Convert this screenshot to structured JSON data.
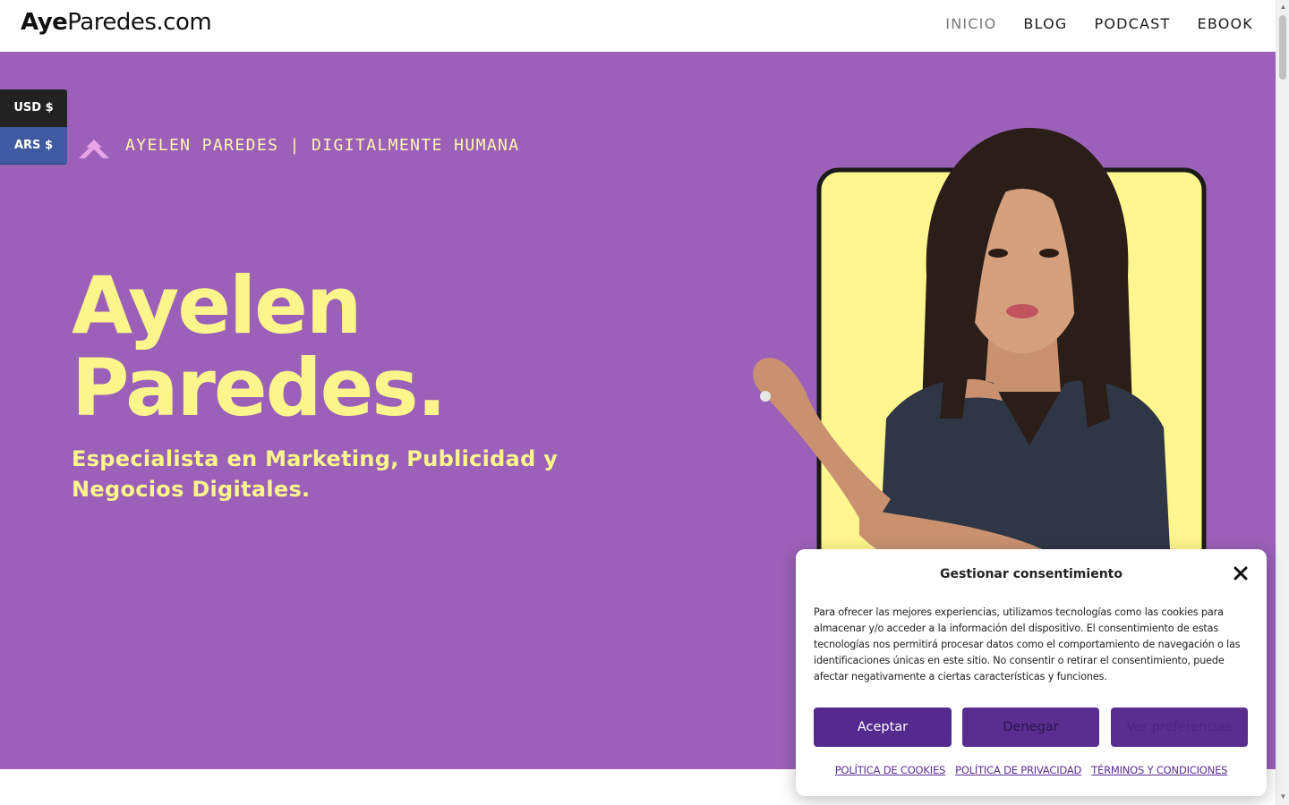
{
  "header": {
    "logo_bold": "Aye",
    "logo_light": "Paredes.com",
    "nav": [
      {
        "label": "INICIO",
        "active": true
      },
      {
        "label": "BLOG",
        "active": false
      },
      {
        "label": "PODCAST",
        "active": false
      },
      {
        "label": "EBOOK",
        "active": false
      }
    ]
  },
  "currency": {
    "options": [
      "USD $",
      "ARS $"
    ]
  },
  "hero": {
    "tagline": "AYELEN PAREDES | DIGITALMENTE HUMANA",
    "name_line1": "Ayelen",
    "name_line2": "Paredes.",
    "subtitle": "Especialista en Marketing, Publicidad y Negocios Digitales.",
    "colors": {
      "background": "#9b61b8",
      "headline": "#fbf58c",
      "photo_frame": "#fff68f"
    }
  },
  "consent": {
    "title": "Gestionar consentimiento",
    "body": "Para ofrecer las mejores experiencias, utilizamos tecnologías como las cookies para almacenar y/o acceder a la información del dispositivo. El consentimiento de estas tecnologías nos permitirá procesar datos como el comportamiento de navegación o las identificaciones únicas en este sitio. No consentir o retirar el consentimiento, puede afectar negativamente a ciertas características y funciones.",
    "accept_label": "Aceptar",
    "deny_label": "Denegar",
    "prefs_label": "Ver preferencias",
    "links": [
      "POLÍTICA DE COOKIES",
      "POLÍTICA DE PRIVACIDAD",
      "TÉRMINOS Y CONDICIONES"
    ],
    "accent": "#5a2d91"
  }
}
